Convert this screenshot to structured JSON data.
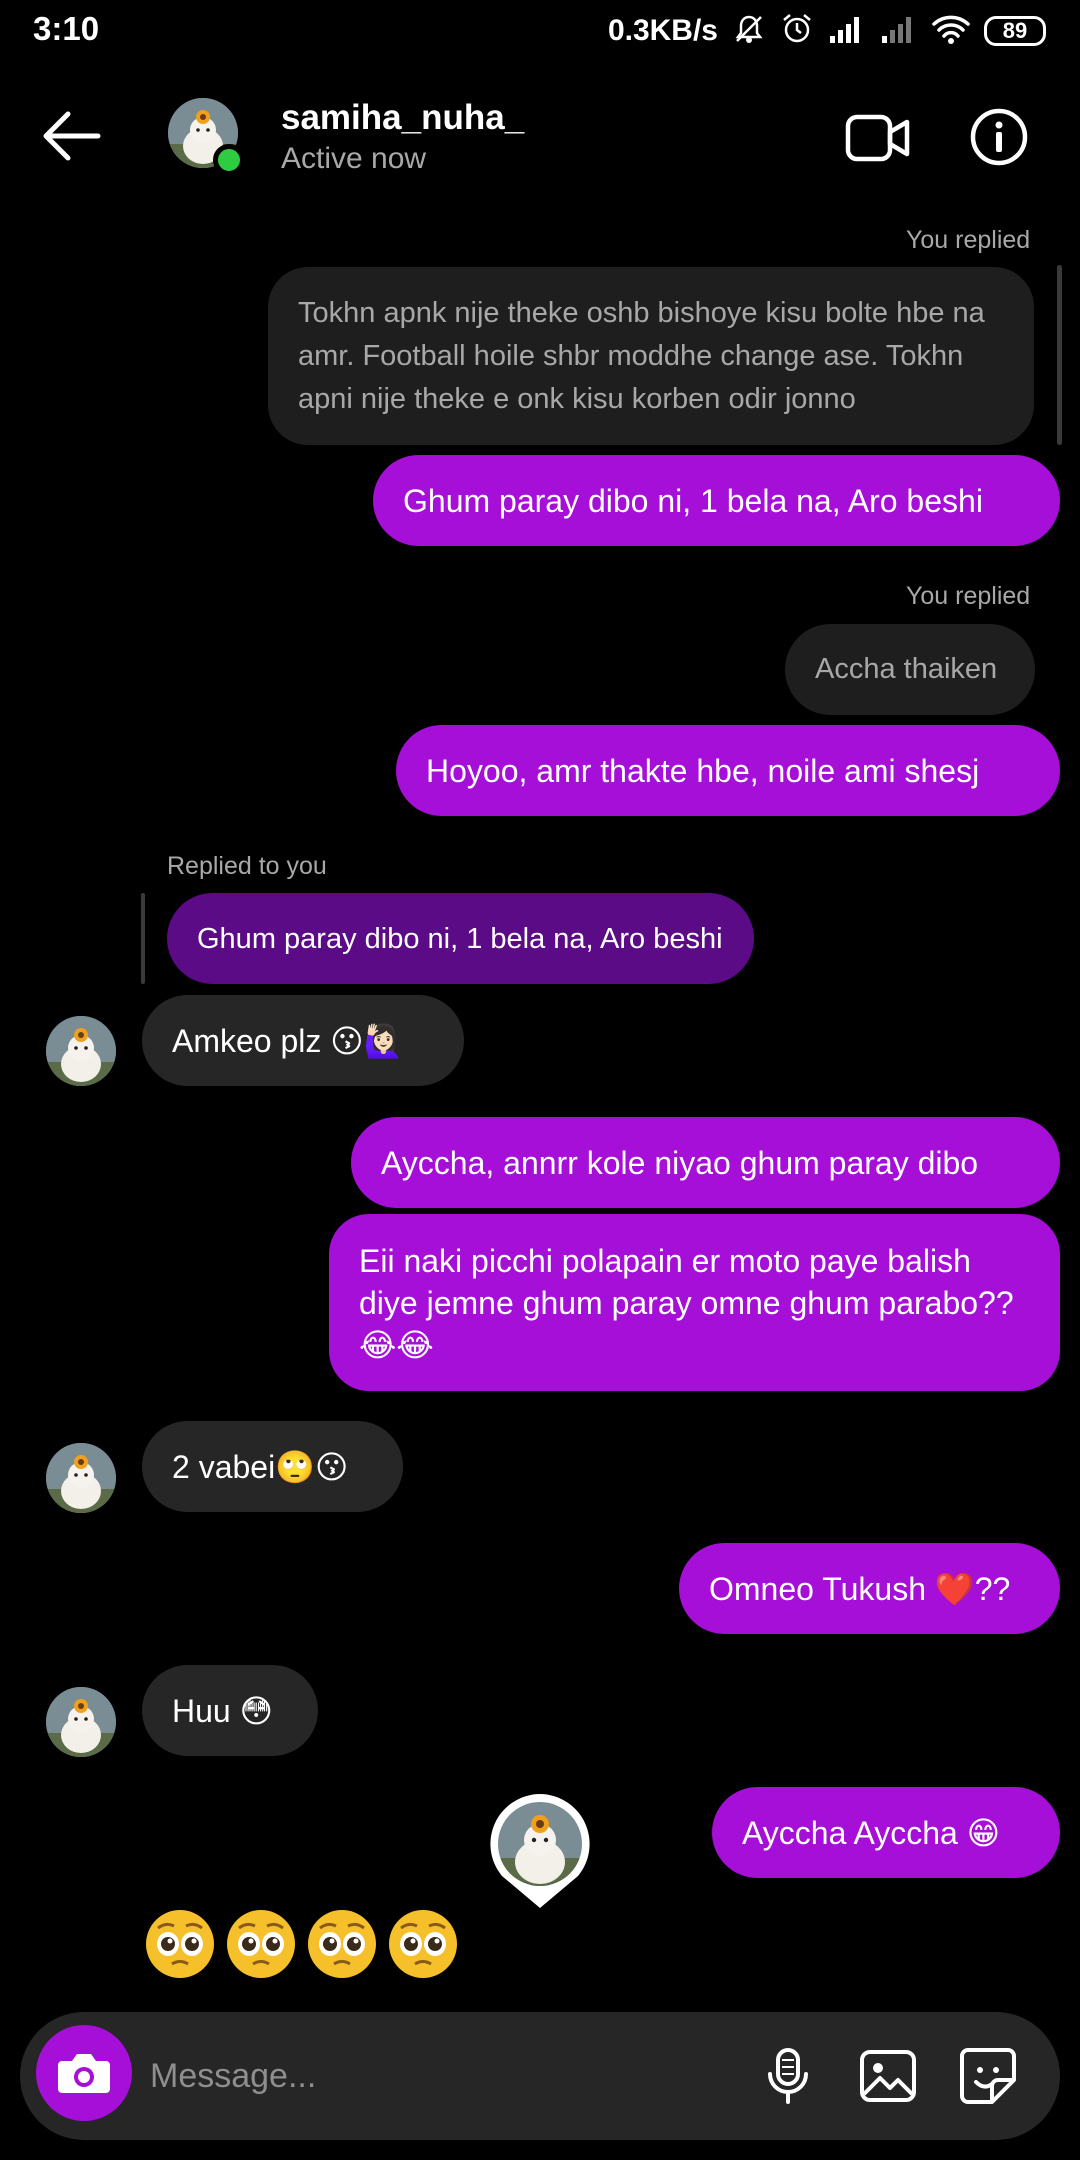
{
  "status_bar": {
    "time": "3:10",
    "network_speed": "0.3KB/s",
    "battery": "89",
    "icons": [
      "mute-icon",
      "alarm-icon",
      "signal-icon",
      "signal-weak-icon",
      "wifi-icon",
      "battery-icon"
    ]
  },
  "header": {
    "username": "samiha_nuha_",
    "status": "Active now",
    "icons": [
      "back-arrow-icon",
      "video-call-icon",
      "info-icon"
    ]
  },
  "messages": {
    "you_replied_1": "You replied",
    "quoted_1": "Tokhn apnk nije theke oshb bishoye kisu bolte hbe na amr. Football hoile shbr moddhe change ase. Tokhn apni nije theke e onk kisu korben odir jonno",
    "sent_1": "Ghum paray dibo ni, 1 bela na, Aro beshi",
    "you_replied_2": "You replied",
    "quoted_2": "Accha thaiken",
    "sent_2": "Hoyoo, amr thakte hbe, noile ami shesj",
    "replied_to_you": "Replied to you",
    "reply_quote": "Ghum paray dibo ni, 1 bela na, Aro beshi",
    "recv_1": "Amkeo plz 😗🙋🏻‍♀️",
    "sent_3": "Ayccha, annrr kole niyao ghum paray dibo",
    "sent_4": "Eii naki picchi polapain er moto paye balish diye jemne ghum paray omne ghum parabo?? 😂😂",
    "recv_2": "2 vabei🙄😗",
    "sent_5": "Omneo Tukush ❤️??",
    "recv_3": "Huu 😳",
    "sent_6": "Ayccha Ayccha 😁",
    "recv_big_emoji": "🥺🥺🥺🥺"
  },
  "composer": {
    "placeholder": "Message...",
    "icons": [
      "camera-icon",
      "microphone-icon",
      "gallery-icon",
      "sticker-icon"
    ]
  },
  "colors": {
    "sent_bubble": "#a50fd8",
    "received_bubble": "#262626",
    "reply_purple": "#5b0b86",
    "online": "#2ecc40"
  }
}
